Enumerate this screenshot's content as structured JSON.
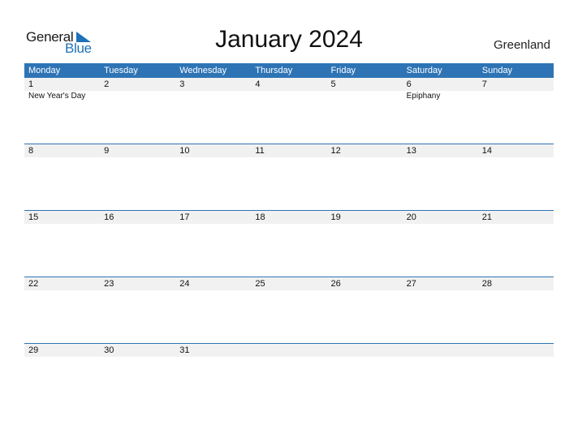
{
  "logo": {
    "general": "General",
    "blue": "Blue"
  },
  "title": "January 2024",
  "region": "Greenland",
  "weekdays": [
    "Monday",
    "Tuesday",
    "Wednesday",
    "Thursday",
    "Friday",
    "Saturday",
    "Sunday"
  ],
  "weeks": [
    {
      "days": [
        "1",
        "2",
        "3",
        "4",
        "5",
        "6",
        "7"
      ],
      "events": [
        "New Year's Day",
        "",
        "",
        "",
        "",
        "Epiphany",
        ""
      ]
    },
    {
      "days": [
        "8",
        "9",
        "10",
        "11",
        "12",
        "13",
        "14"
      ],
      "events": [
        "",
        "",
        "",
        "",
        "",
        "",
        ""
      ]
    },
    {
      "days": [
        "15",
        "16",
        "17",
        "18",
        "19",
        "20",
        "21"
      ],
      "events": [
        "",
        "",
        "",
        "",
        "",
        "",
        ""
      ]
    },
    {
      "days": [
        "22",
        "23",
        "24",
        "25",
        "26",
        "27",
        "28"
      ],
      "events": [
        "",
        "",
        "",
        "",
        "",
        "",
        ""
      ]
    },
    {
      "days": [
        "29",
        "30",
        "31",
        "",
        "",
        "",
        ""
      ],
      "events": [
        "",
        "",
        "",
        "",
        "",
        "",
        ""
      ]
    }
  ],
  "colors": {
    "accent": "#2e74b5",
    "row_bg": "#f1f1f1"
  }
}
